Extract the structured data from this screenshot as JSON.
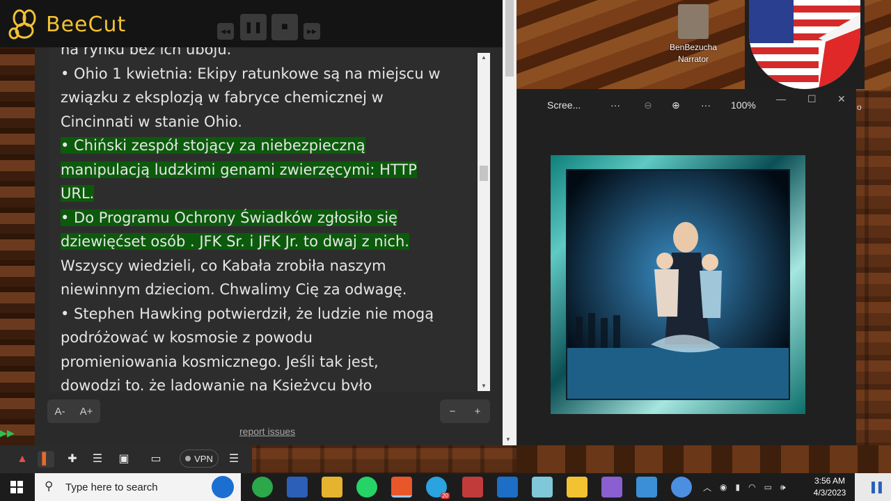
{
  "app": {
    "name": "BeeCut"
  },
  "reader": {
    "partial_top": "na rynku bez ich uboju.",
    "lines": [
      {
        "text": "• Ohio 1 kwietnia: Ekipy ratunkowe są na miejscu w",
        "hl": false
      },
      {
        "text": "związku z eksplozją w fabryce chemicznej w",
        "hl": false
      },
      {
        "text": "Cincinnati w stanie Ohio.",
        "hl": false
      },
      {
        "text": "• Chiński zespół stojący za niebezpieczną",
        "hl": true
      },
      {
        "text": "manipulacją ludzkimi genami zwierzęcymi: HTTP",
        "hl": true
      },
      {
        "text": "URL.",
        "hl": true
      },
      {
        "text": "• Do Programu Ochrony Świadków zgłosiło się",
        "hl": true
      },
      {
        "text": "dziewięćset osób . JFK Sr. i JFK Jr. to dwaj z nich.",
        "hl": true
      },
      {
        "text": "Wszyscy wiedzieli, co Kabała zrobiła naszym",
        "hl": false
      },
      {
        "text": "niewinnym dzieciom. Chwalimy Cię za odwagę.",
        "hl": false
      },
      {
        "text": "• Stephen Hawking potwierdził, że ludzie nie mogą",
        "hl": false
      },
      {
        "text": "podróżować w kosmosie z powodu",
        "hl": false
      },
      {
        "text": "promieniowania kosmicznego. Jeśli tak jest,",
        "hl": false
      },
      {
        "text": "dowodzi to. że ladowanie na Ksieżvcu bvło",
        "hl": false
      }
    ],
    "font_decrease": "A-",
    "font_increase": "A+",
    "zoom_minus": "−",
    "zoom_plus": "+",
    "report_link": "report issues"
  },
  "participants": {
    "user_name": "BenBezucha",
    "user_role": "Narrator"
  },
  "viewer": {
    "title": "Scree...",
    "more1": "···",
    "more2": "···",
    "zoom": "100%",
    "extra_glyph": "o"
  },
  "browser_toolbar": {
    "vpn_label": "VPN"
  },
  "taskbar": {
    "search_placeholder": "Type here to search",
    "telegram_badge": "20",
    "time": "3:56 AM",
    "date": "4/3/2023"
  },
  "colors": {
    "highlight": "#0c5a0c",
    "brand": "#f2c232"
  }
}
